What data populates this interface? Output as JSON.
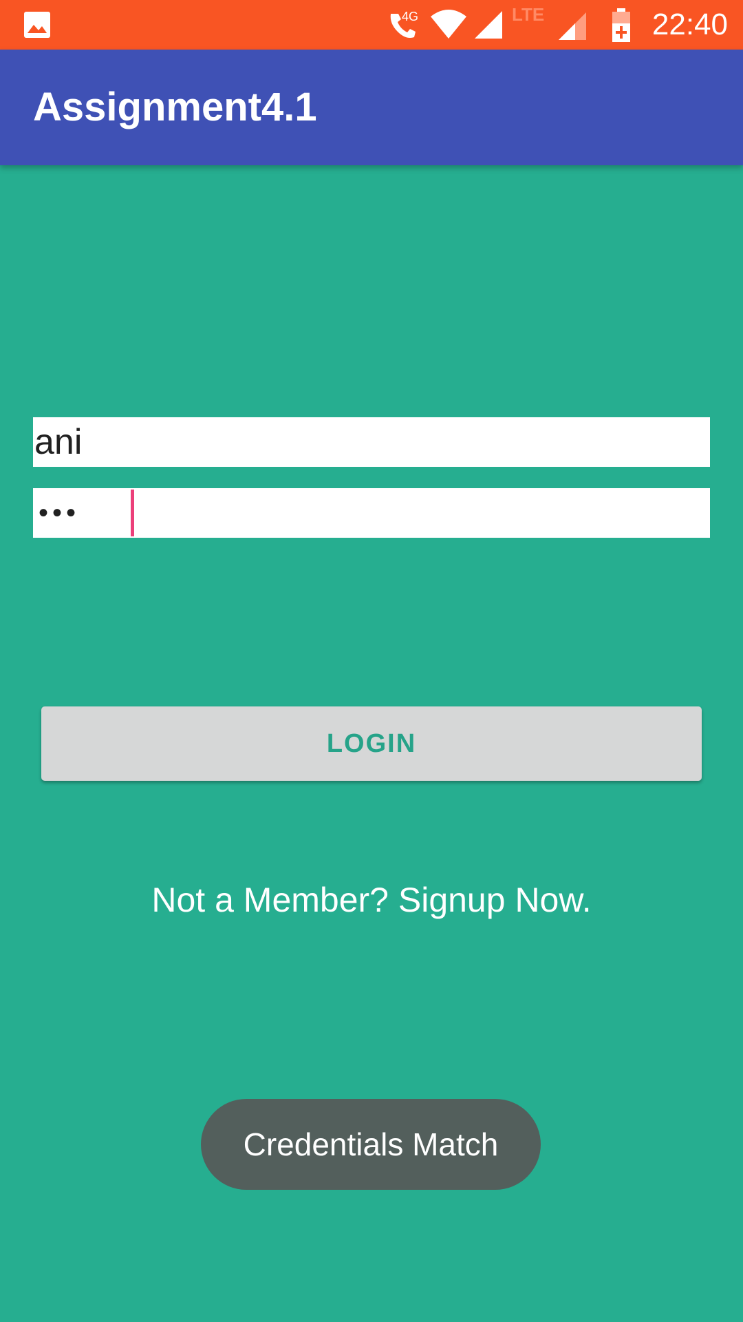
{
  "status_bar": {
    "time": "22:40",
    "network_label": "4G",
    "lte_label": "LTE",
    "icons": [
      "image-notification-icon",
      "call-icon",
      "wifi-icon",
      "signal-icon",
      "lte-signal-icon",
      "battery-charging-icon"
    ],
    "background_color": "#f95523"
  },
  "app_bar": {
    "title": "Assignment4.1",
    "background_color": "#3f51b5"
  },
  "form": {
    "username_value": "ani",
    "password_masked": "•••"
  },
  "login_button": {
    "label": "LOGIN"
  },
  "signup_link": {
    "label": "Not a Member? Signup Now."
  },
  "toast": {
    "message": "Credentials Match"
  },
  "colors": {
    "background": "#26ae90",
    "cursor": "#ec407a",
    "button_text": "#26a389"
  }
}
